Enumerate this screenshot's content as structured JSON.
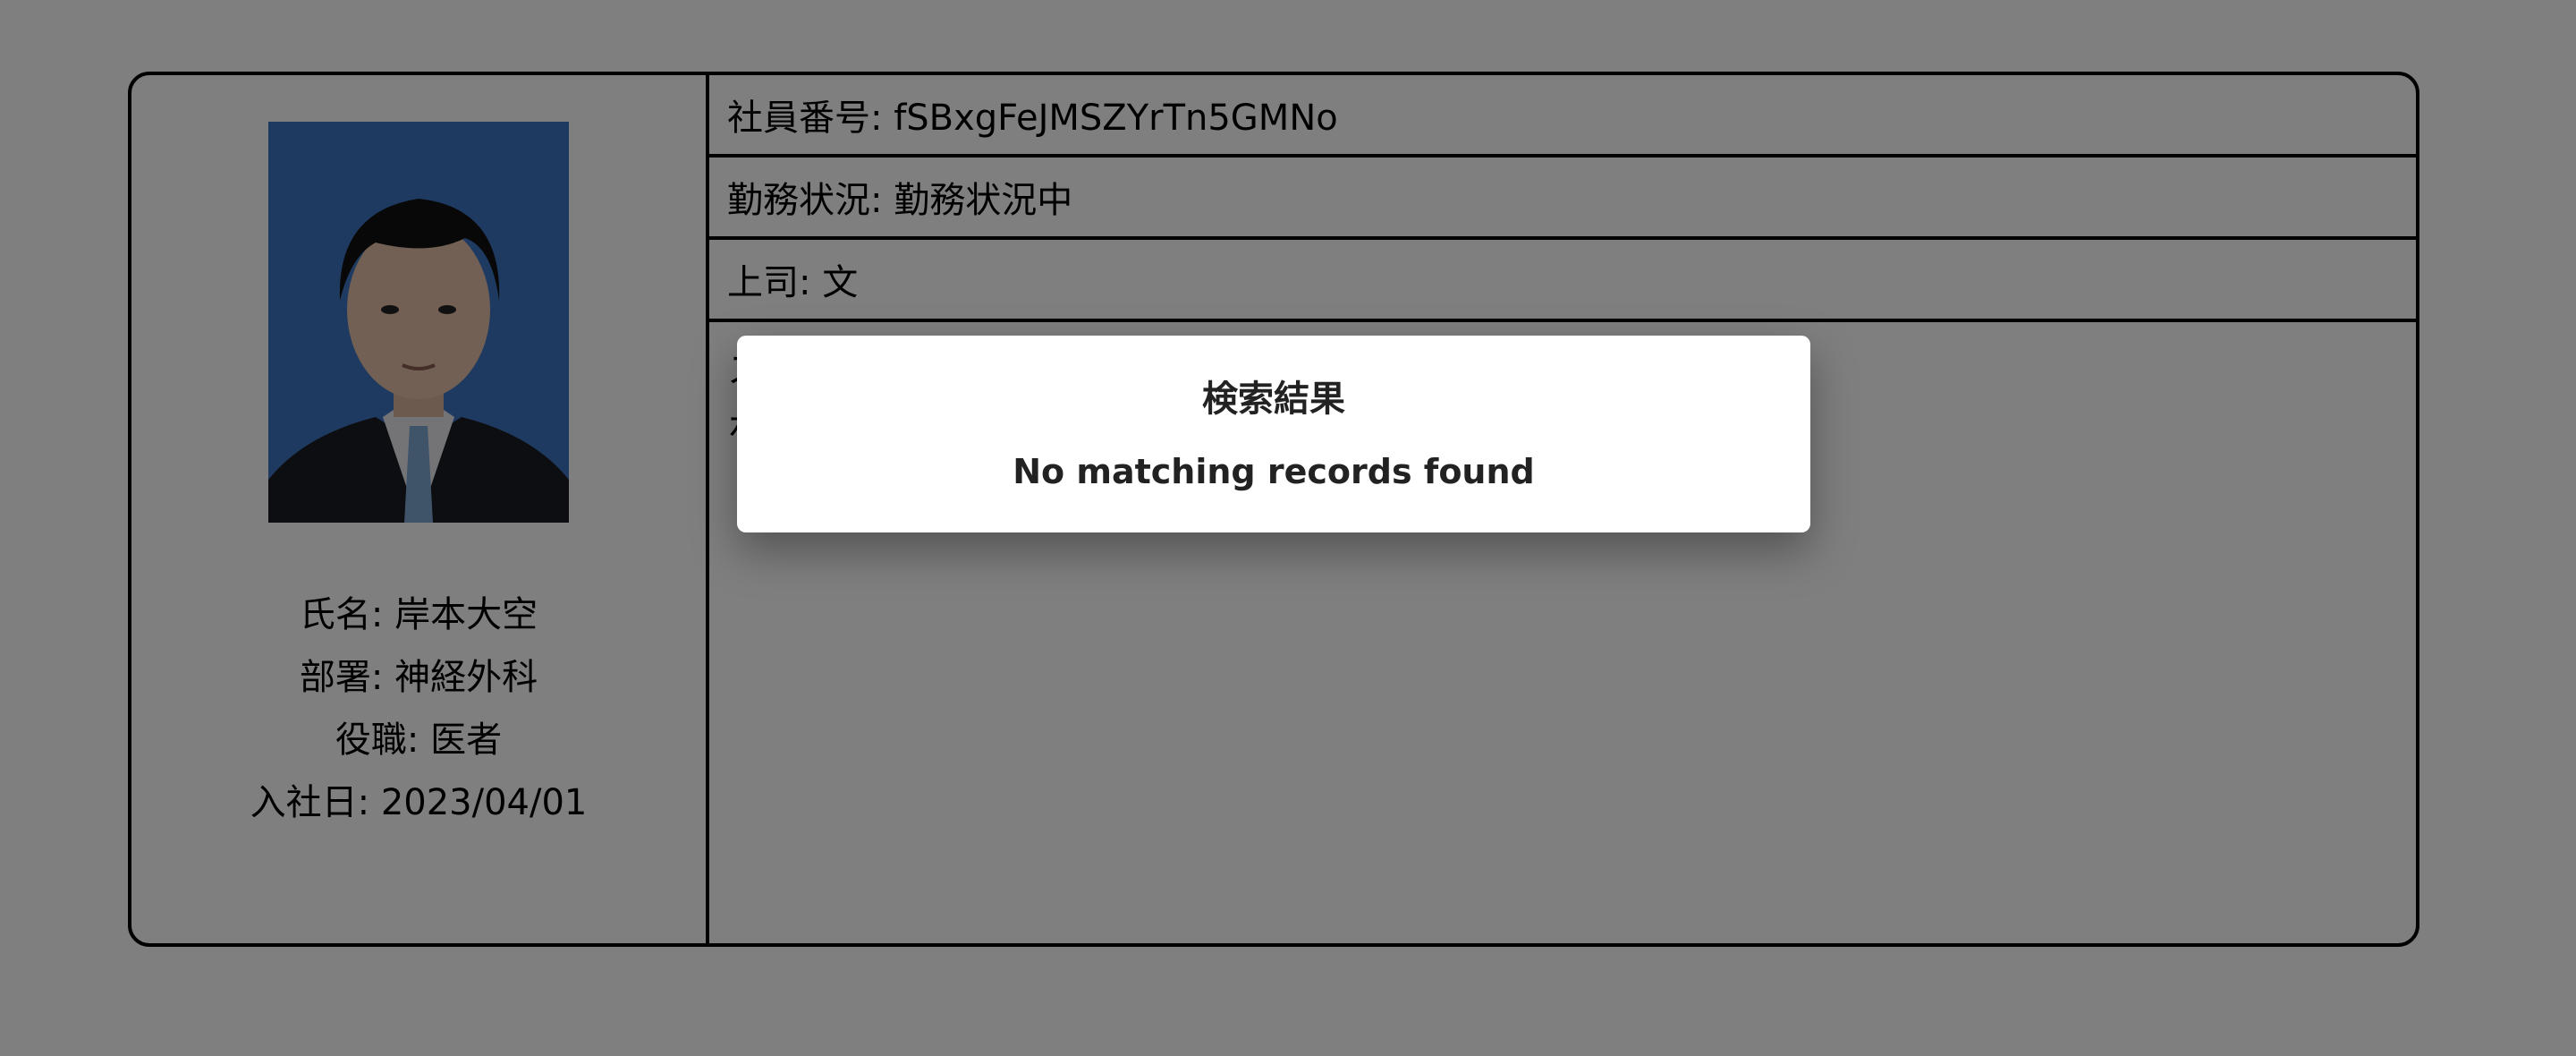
{
  "employee": {
    "name_line": "氏名: 岸本大空",
    "department_line": "部署: 神経外科",
    "position_line": "役職: 医者",
    "hire_date_line": "入社日: 2023/04/01",
    "id_line": "社員番号: fSBxgFeJMSZYrTn5GMNo",
    "status_line": "勤務状況: 勤務状況中",
    "supervisor_line": "上司: 文",
    "body_line_1_visible": "ス",
    "body_line_2_visible": "ホ"
  },
  "dialog": {
    "title": "検索結果",
    "message": "No matching records found"
  },
  "colors": {
    "photo_background": "#3f74c0",
    "overlay": "rgba(0,0,0,0.5)"
  }
}
